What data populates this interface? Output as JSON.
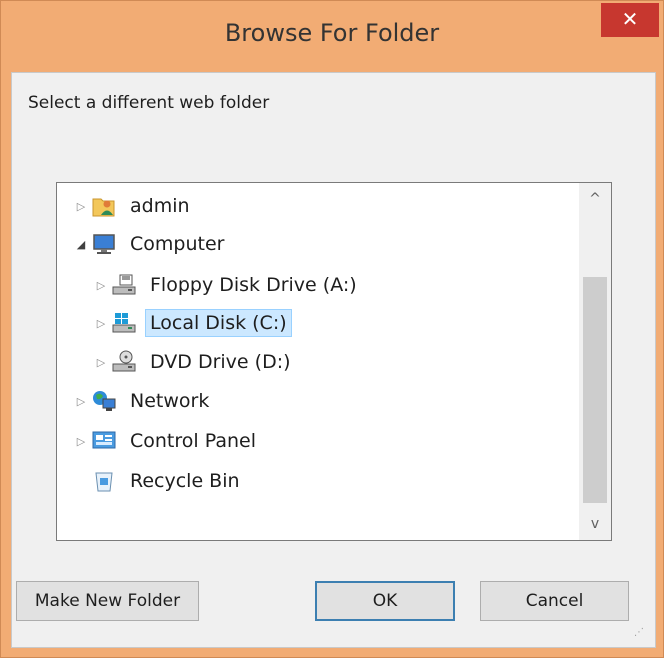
{
  "window": {
    "title": "Browse For Folder",
    "close_glyph": "✕"
  },
  "dialog": {
    "prompt": "Select a different web folder"
  },
  "tree": {
    "items": [
      {
        "label": "admin",
        "icon": "user-folder-icon"
      },
      {
        "label": "Computer",
        "icon": "computer-icon"
      },
      {
        "label": "Floppy Disk Drive (A:)",
        "icon": "floppy-drive-icon"
      },
      {
        "label": "Local Disk (C:)",
        "icon": "local-disk-icon"
      },
      {
        "label": "DVD Drive (D:)",
        "icon": "dvd-drive-icon"
      },
      {
        "label": "Network",
        "icon": "network-icon"
      },
      {
        "label": "Control Panel",
        "icon": "control-panel-icon"
      },
      {
        "label": "Recycle Bin",
        "icon": "recycle-bin-icon"
      }
    ],
    "collapsed_arrow": "▷",
    "expanded_arrow": "◢",
    "selected_item": "Local Disk (C:)"
  },
  "scrollbar": {
    "up_glyph": "^",
    "down_glyph": "v"
  },
  "buttons": {
    "make_new_folder": "Make New Folder",
    "ok": "OK",
    "cancel": "Cancel"
  },
  "colors": {
    "titlebar": "#f2ac74",
    "close": "#c7372f",
    "selection": "#cce8ff"
  }
}
